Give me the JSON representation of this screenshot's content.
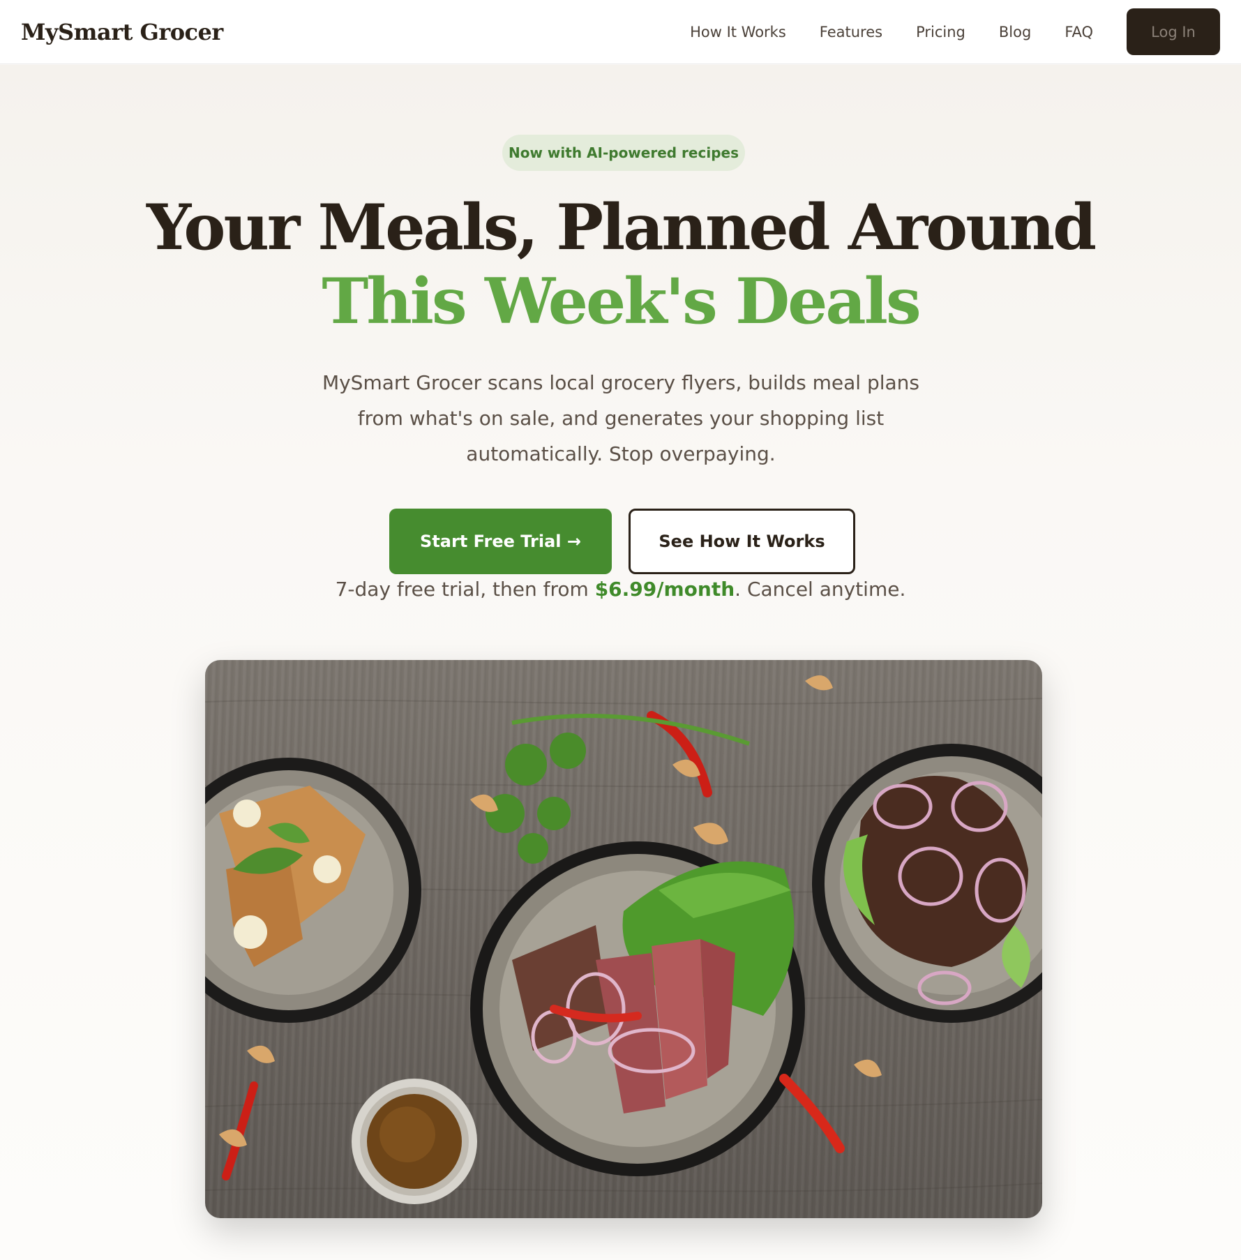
{
  "brand": {
    "name": "MySmart Grocer"
  },
  "nav": {
    "links": [
      "How It Works",
      "Features",
      "Pricing",
      "Blog",
      "FAQ"
    ],
    "login_label": "Log In"
  },
  "hero": {
    "badge": "Now with AI-powered recipes",
    "headline_line1": "Your Meals, Planned Around",
    "headline_line2": "This Week's Deals",
    "subtitle": "MySmart Grocer scans local grocery flyers, builds meal plans from what's on sale, and generates your shopping list automatically. Stop overpaying.",
    "primary_cta": "Start Free Trial →",
    "secondary_cta": "See How It Works",
    "trial_note_prefix": "7-day free trial, then from ",
    "trial_note_price": "$6.99/month",
    "trial_note_suffix": ". Cancel anytime."
  },
  "colors": {
    "brand_dark": "#2a2118",
    "brand_green": "#468c2f",
    "accent_green": "#62a845",
    "badge_bg": "#e4ecdb"
  },
  "hero_image": {
    "alt": "Overhead photo of three bowls of meals with steak, salad and seasoning on a wooden table"
  }
}
